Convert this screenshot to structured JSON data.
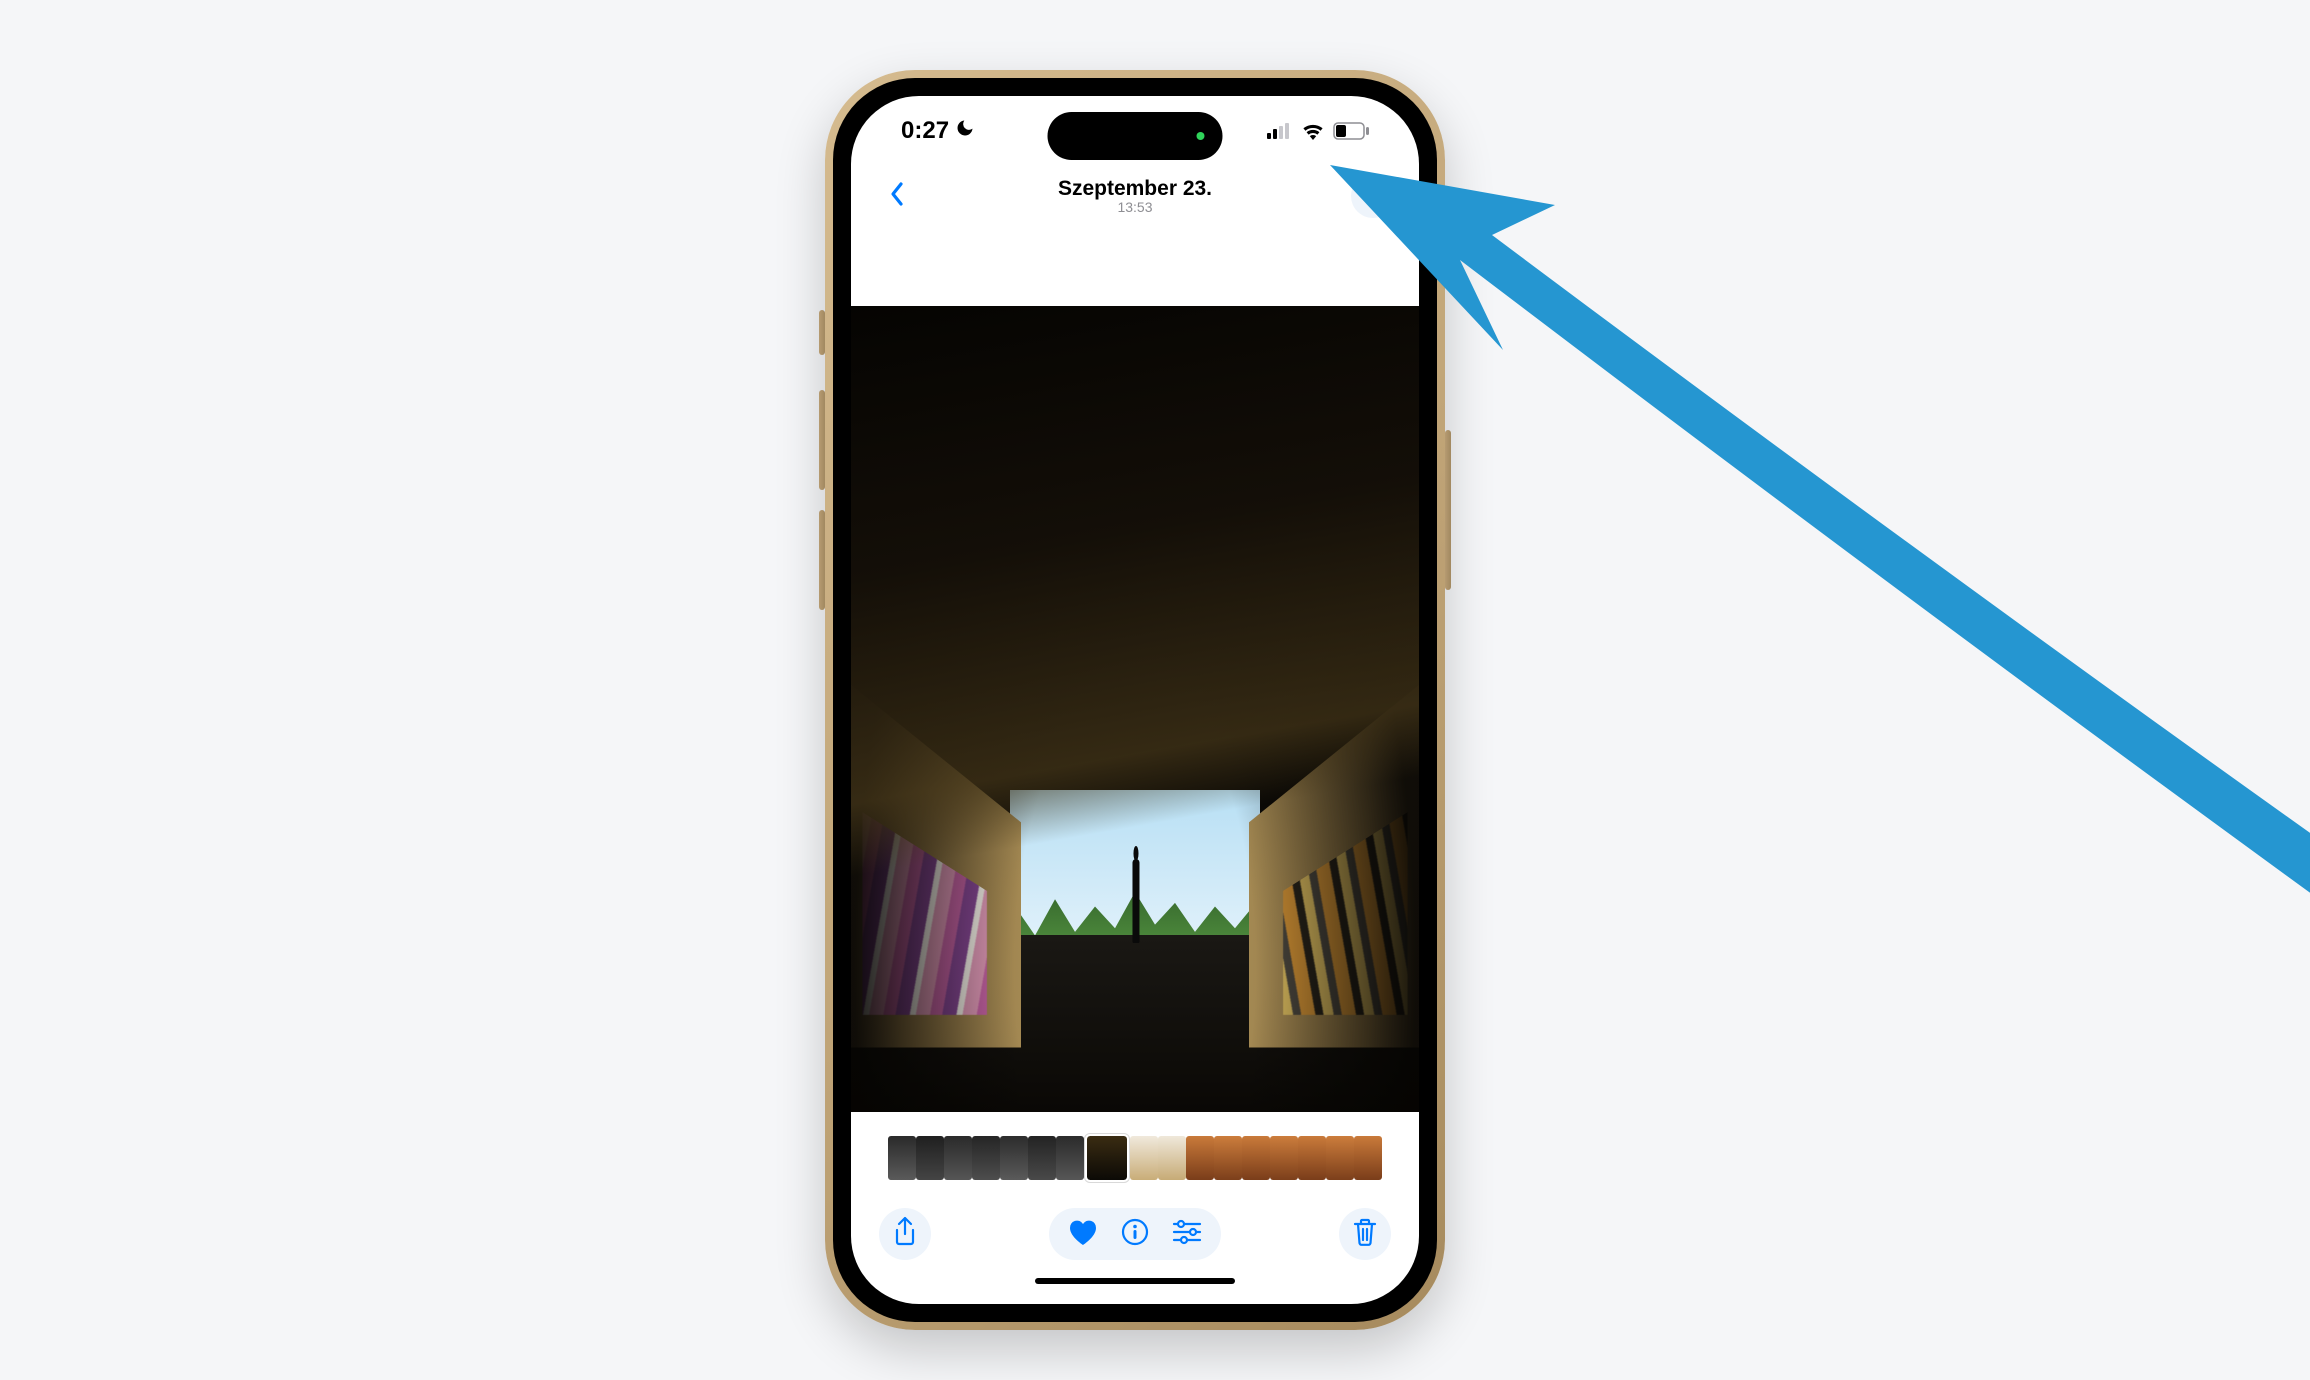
{
  "status": {
    "time": "0:27",
    "moon": "☾",
    "cell_bars": 2,
    "wifi": true,
    "battery_pct": 35
  },
  "nav": {
    "date": "Szeptember 23.",
    "time": "13:53"
  },
  "toolbar": {
    "share": "share-icon",
    "favorite": "heart-icon",
    "info": "info-icon",
    "adjust": "adjust-icon",
    "delete": "trash-icon"
  },
  "thumbnails": [
    {
      "bg": "linear-gradient(#2a2a2a,#5a5a5a)"
    },
    {
      "bg": "linear-gradient(#1f1f1f,#444)"
    },
    {
      "bg": "linear-gradient(#2a2a2a,#555)"
    },
    {
      "bg": "linear-gradient(#252525,#4d4d4d)"
    },
    {
      "bg": "linear-gradient(#2c2c2c,#5a5a5a)"
    },
    {
      "bg": "linear-gradient(#232323,#494949)"
    },
    {
      "bg": "linear-gradient(#2b2b2b,#565656)"
    },
    {
      "bg": "linear-gradient(#3a2c12,#0c0a06)",
      "active": true
    },
    {
      "bg": "linear-gradient(#f0e9dc,#c9ad78)"
    },
    {
      "bg": "linear-gradient(#efe8da,#c7ab76)"
    },
    {
      "bg": "linear-gradient(#c97a3a,#7a3d1a)"
    },
    {
      "bg": "linear-gradient(#cc7d3c,#7c3f1b)"
    },
    {
      "bg": "linear-gradient(#c97a3a,#7a3d1a)"
    },
    {
      "bg": "linear-gradient(#cc7d3c,#7c3f1b)"
    },
    {
      "bg": "linear-gradient(#c97a3a,#7a3d1a)"
    },
    {
      "bg": "linear-gradient(#cc7d3c,#7c3f1b)"
    },
    {
      "bg": "linear-gradient(#c97a3a,#7a3d1a)"
    }
  ],
  "colors": {
    "ios_blue": "#007aff",
    "arrow": "#2596d1"
  }
}
